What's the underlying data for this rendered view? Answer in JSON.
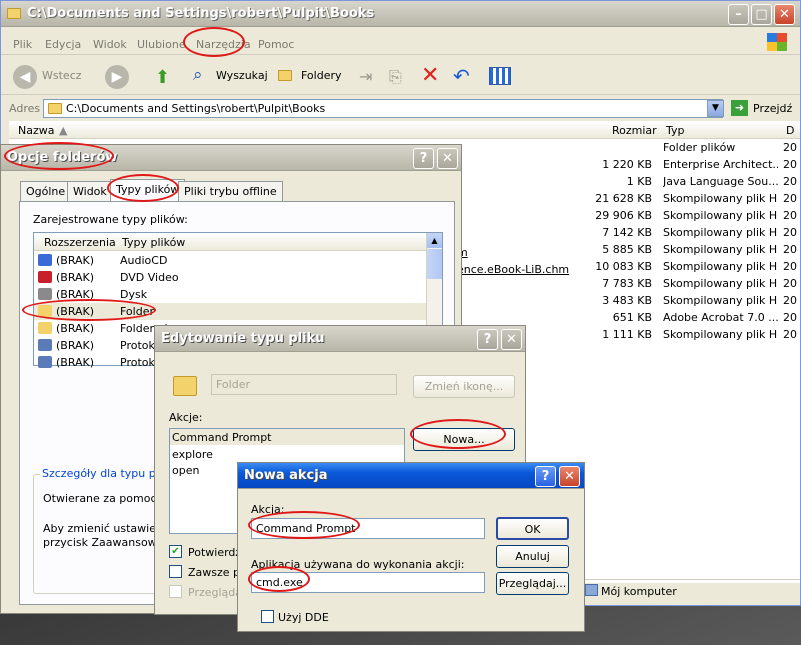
{
  "explorer": {
    "title": "C:\\Documents and Settings\\robert\\Pulpit\\Books",
    "menu": [
      "Plik",
      "Edycja",
      "Widok",
      "Ulubione",
      "Narzędzia",
      "Pomoc"
    ],
    "toolbar": {
      "back": "Wstecz",
      "search": "Wyszukaj",
      "folders": "Foldery"
    },
    "address": {
      "label": "Adres",
      "value": "C:\\Documents and Settings\\robert\\Pulpit\\Books",
      "go": "Przejdź"
    },
    "columns": {
      "name": "Nazwa",
      "size": "Rozmiar",
      "type": "Typ",
      "date": "D"
    },
    "rows": [
      {
        "size": "",
        "type": "Folder plików",
        "date": "20"
      },
      {
        "size": "1 220 KB",
        "type": "Enterprise Architect...",
        "date": "20"
      },
      {
        "size": "1 KB",
        "type": "Java Language Sou...",
        "date": "20"
      },
      {
        "size": "21 628 KB",
        "type": "Skompilowany plik H...",
        "date": "20"
      },
      {
        "size": "29 906 KB",
        "type": "Skompilowany plik H...",
        "date": "20"
      },
      {
        "size": "7 142 KB",
        "type": "Skompilowany plik H...",
        "date": "20"
      },
      {
        "size": "5 885 KB",
        "type": "Skompilowany plik H...",
        "date": "20"
      },
      {
        "size": "10 083 KB",
        "type": "Skompilowany plik H...",
        "date": "20"
      },
      {
        "size": "7 783 KB",
        "type": "Skompilowany plik H...",
        "date": "20"
      },
      {
        "size": "3 483 KB",
        "type": "Skompilowany plik H...",
        "date": "20"
      },
      {
        "size": "651 KB",
        "type": "Adobe Acrobat 7.0 ...",
        "date": "20"
      },
      {
        "size": "1 111 KB",
        "type": "Skompilowany plik H...",
        "date": "20"
      }
    ],
    "partial_names": [
      "m",
      "ence.eBook-LiB.chm"
    ],
    "status": "Mój komputer"
  },
  "folder_options": {
    "title": "Opcje folderów",
    "tabs": [
      "Ogólne",
      "Widok",
      "Typy plików",
      "Pliki trybu offline"
    ],
    "registered_label": "Zarejestrowane typy plików:",
    "list_headers": {
      "ext": "Rozszerzenia",
      "type": "Typy plików"
    },
    "items": [
      {
        "ext": "(BRAK)",
        "type": "AudioCD"
      },
      {
        "ext": "(BRAK)",
        "type": "DVD Video"
      },
      {
        "ext": "(BRAK)",
        "type": "Dysk"
      },
      {
        "ext": "(BRAK)",
        "type": "Folder"
      },
      {
        "ext": "(BRAK)",
        "type": "Folder pl"
      },
      {
        "ext": "(BRAK)",
        "type": "Protokó"
      },
      {
        "ext": "(BRAK)",
        "type": "Protokó"
      }
    ],
    "details_label": "Szczegóły dla typu plików",
    "opens_with": "Otwierane za pomocą:",
    "change_hint_1": "Aby zmienić ustawienia",
    "change_hint_2": "przycisk Zaawansowan"
  },
  "edit_type": {
    "title": "Edytowanie typu pliku",
    "name_value": "Folder",
    "change_icon": "Zmień ikonę...",
    "actions_label": "Akcje:",
    "actions": [
      "Command Prompt",
      "explore",
      "open"
    ],
    "new_button": "Nowa...",
    "confirm_label": "Potwierdź",
    "always_label": "Zawsze po",
    "browse_label": "Przeglądaj"
  },
  "new_action": {
    "title": "Nowa akcja",
    "action_label": "Akcja:",
    "action_value": "Command Prompt",
    "app_label": "Aplikacja używana do wykonania akcji:",
    "app_value": "cmd.exe",
    "dde_label": "Użyj DDE",
    "ok": "OK",
    "cancel": "Anuluj",
    "browse": "Przeglądaj..."
  }
}
